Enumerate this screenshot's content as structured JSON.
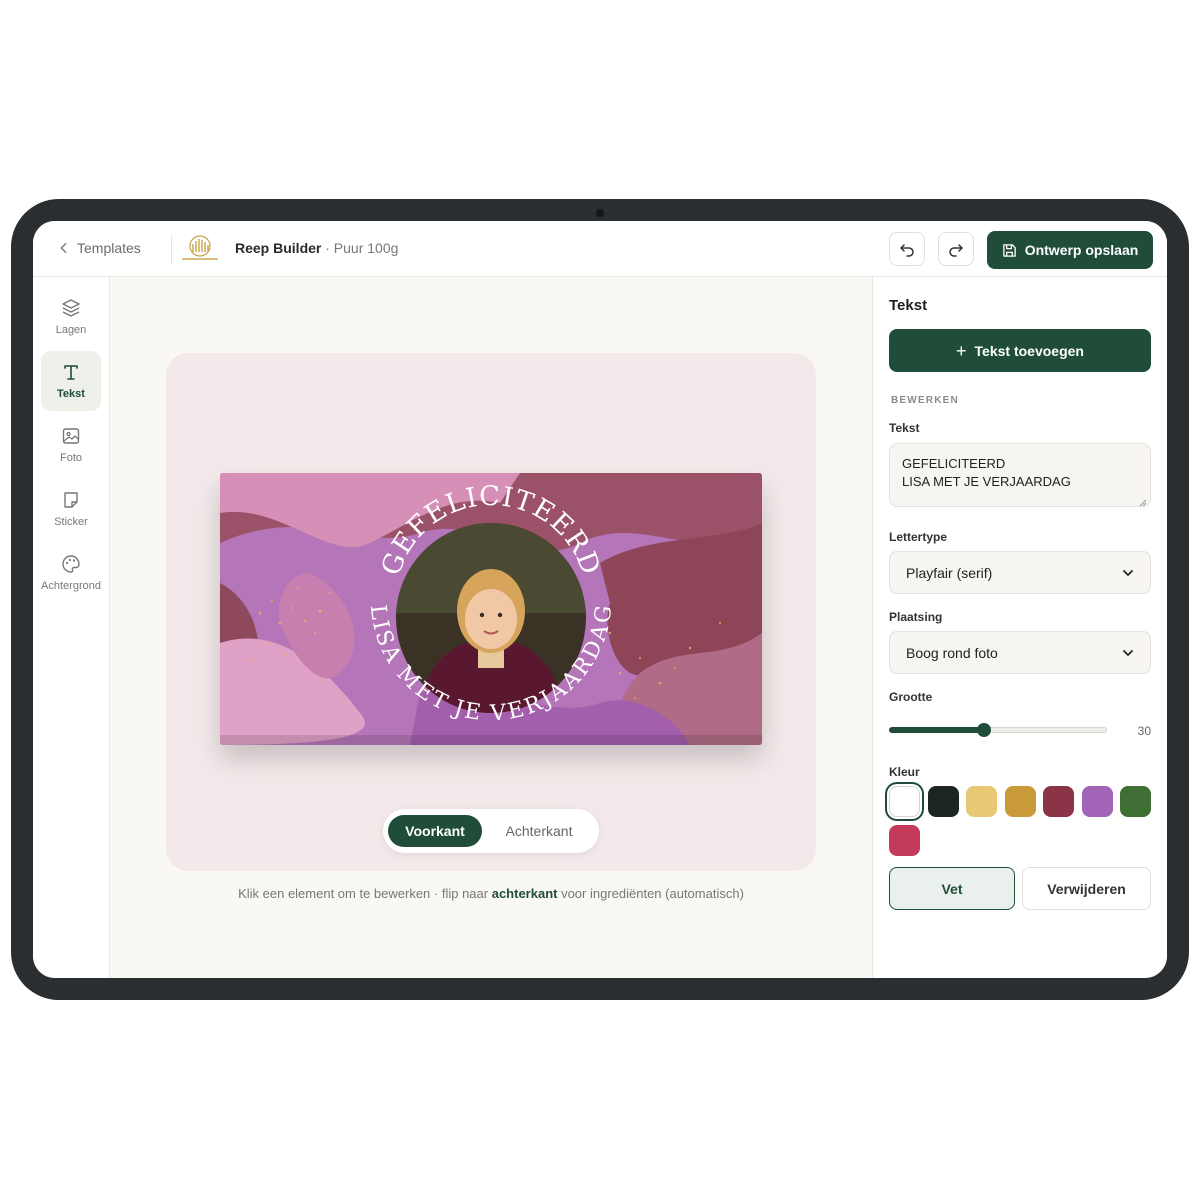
{
  "topbar": {
    "back_label": "Templates",
    "product_name": "Reep Builder",
    "product_sub": "· Puur 100g",
    "save_label": "Ontwerp opslaan"
  },
  "tools": [
    {
      "label": "Lagen",
      "icon": "layers-icon"
    },
    {
      "label": "Tekst",
      "icon": "text-icon"
    },
    {
      "label": "Foto",
      "icon": "image-icon"
    },
    {
      "label": "Sticker",
      "icon": "sticker-icon"
    },
    {
      "label": "Achtergrond",
      "icon": "palette-icon"
    }
  ],
  "active_tool": "Tekst",
  "canvas": {
    "arc_top": "GEFELICITEERD",
    "arc_bottom": "LISA MET JE VERJAARDAG",
    "sides": [
      "Voorkant",
      "Achterkant"
    ],
    "active_side": "Voorkant",
    "hint_before": "Klik een element om te bewerken · flip naar ",
    "hint_bold": "achterkant",
    "hint_after": " voor ingrediënten (automatisch)"
  },
  "panel": {
    "title": "Tekst",
    "add_label": "Tekst toevoegen",
    "section": "BEWERKEN",
    "text_label": "Tekst",
    "text_value": "GEFELICITEERD\nLISA MET JE VERJAARDAG",
    "font_label": "Lettertype",
    "font_value": "Playfair (serif)",
    "placement_label": "Plaatsing",
    "placement_value": "Boog rond foto",
    "size_label": "Grootte",
    "size_value": "30",
    "size_fraction": 0.43,
    "color_label": "Kleur",
    "colors": [
      "#ffffff",
      "#1c2620",
      "#e8c872",
      "#c99a3a",
      "#8b3448",
      "#a164b6",
      "#3f6f34",
      "#c43a5a"
    ],
    "selected_color": "#ffffff",
    "bold_label": "Vet",
    "delete_label": "Verwijderen"
  }
}
